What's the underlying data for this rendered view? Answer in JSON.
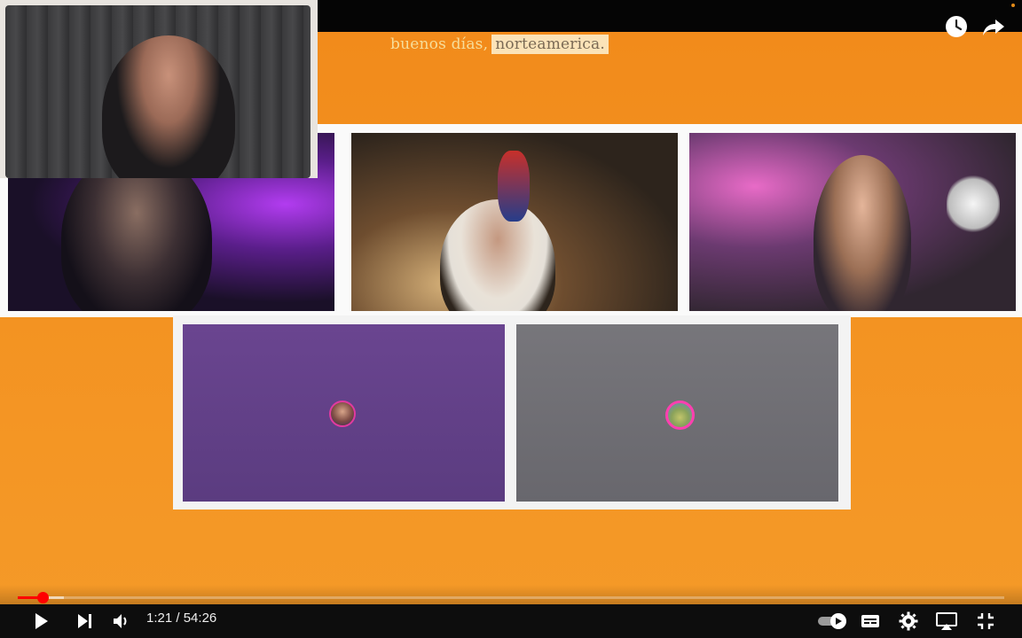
{
  "overlay": {
    "greeting_prefix": "buenos días,",
    "greeting_highlight": "norteamerica."
  },
  "player": {
    "current_time": "1:21",
    "separator": " / ",
    "duration": "54:26",
    "progress_fraction": 0.025,
    "buffered_fraction": 0.047
  },
  "colors": {
    "accent": "#ff0000",
    "background": "#f28a1a",
    "tile_purple": "#6a4590",
    "tile_gray": "#77767b"
  },
  "icons": [
    "watch-later-icon",
    "share-icon",
    "play-icon",
    "next-icon",
    "volume-icon",
    "autoplay-toggle-icon",
    "subtitles-icon",
    "settings-icon",
    "airplay-icon",
    "exit-fullscreen-icon"
  ]
}
